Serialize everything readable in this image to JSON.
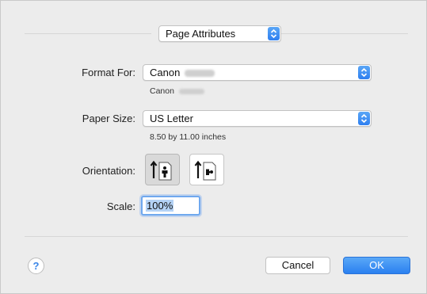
{
  "header": {
    "settings_popup": {
      "value": "Page Attributes"
    }
  },
  "format_for": {
    "label": "Format For:",
    "value": "Canon",
    "sub": "Canon"
  },
  "paper_size": {
    "label": "Paper Size:",
    "value": "US Letter",
    "dimensions": "8.50 by 11.00 inches"
  },
  "orientation": {
    "label": "Orientation:",
    "options": [
      {
        "name": "portrait",
        "icon": "portrait-orientation-icon",
        "selected": true
      },
      {
        "name": "landscape",
        "icon": "landscape-orientation-icon",
        "selected": false
      }
    ]
  },
  "scale": {
    "label": "Scale:",
    "value": "100%"
  },
  "footer": {
    "help": "?",
    "cancel_label": "Cancel",
    "ok_label": "OK"
  },
  "colors": {
    "accent": "#2e7ff0",
    "background": "#ececec"
  }
}
